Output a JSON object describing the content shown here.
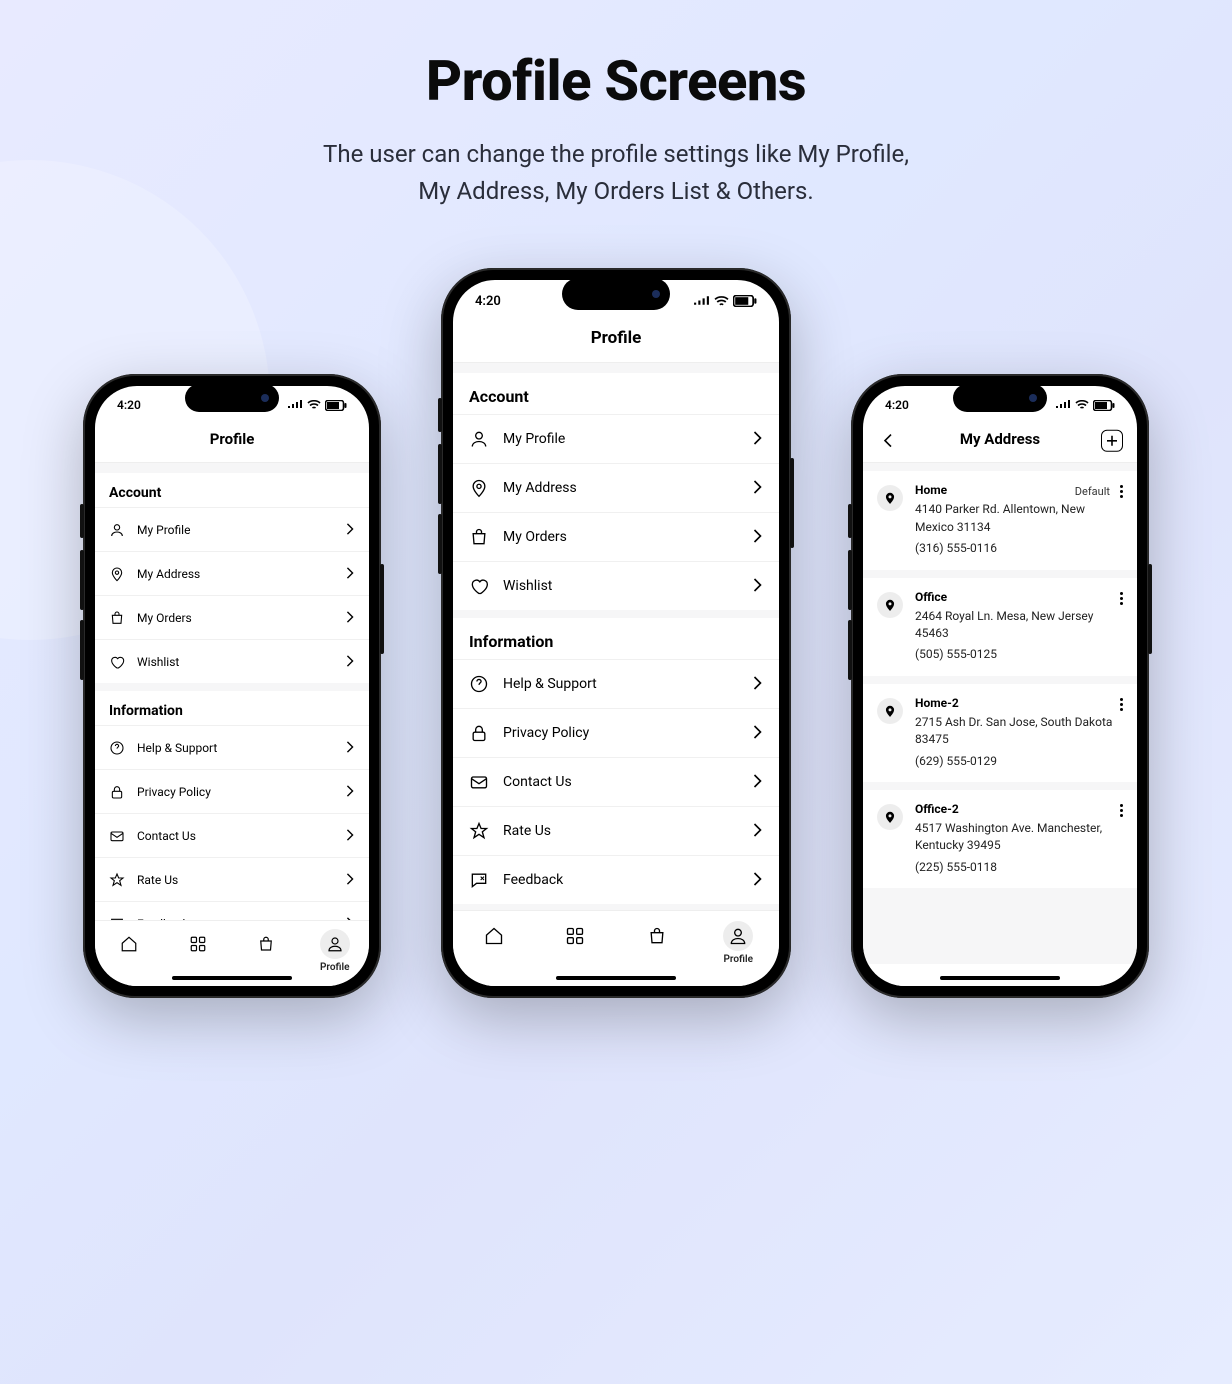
{
  "page": {
    "title": "Profile Screens",
    "subtitle_line1": "The user can change the profile settings like My Profile,",
    "subtitle_line2": "My Address, My Orders List & Others."
  },
  "status": {
    "time": "4:20"
  },
  "profile": {
    "header": "Profile",
    "sections": {
      "account": {
        "title": "Account",
        "items": [
          {
            "label": "My Profile",
            "icon": "user"
          },
          {
            "label": "My Address",
            "icon": "pin"
          },
          {
            "label": "My Orders",
            "icon": "bag"
          },
          {
            "label": "Wishlist",
            "icon": "heart"
          }
        ]
      },
      "information": {
        "title": "Information",
        "items": [
          {
            "label": "Help & Support",
            "icon": "help"
          },
          {
            "label": "Privacy Policy",
            "icon": "lock"
          },
          {
            "label": "Contact Us",
            "icon": "mail"
          },
          {
            "label": "Rate Us",
            "icon": "star"
          },
          {
            "label": "Feedback",
            "icon": "feedback"
          }
        ]
      }
    },
    "tabbar": {
      "active_label": "Profile"
    }
  },
  "address": {
    "header": "My Address",
    "default_label": "Default",
    "items": [
      {
        "title": "Home",
        "address": "4140 Parker Rd. Allentown, New Mexico 31134",
        "phone": "(316) 555-0116",
        "default": true
      },
      {
        "title": "Office",
        "address": "2464 Royal Ln. Mesa, New Jersey 45463",
        "phone": "(505) 555-0125",
        "default": false
      },
      {
        "title": "Home-2",
        "address": "2715 Ash Dr. San Jose, South Dakota 83475",
        "phone": "(629) 555-0129",
        "default": false
      },
      {
        "title": "Office-2",
        "address": "4517 Washington Ave. Manchester, Kentucky 39495",
        "phone": "(225) 555-0118",
        "default": false
      }
    ]
  }
}
